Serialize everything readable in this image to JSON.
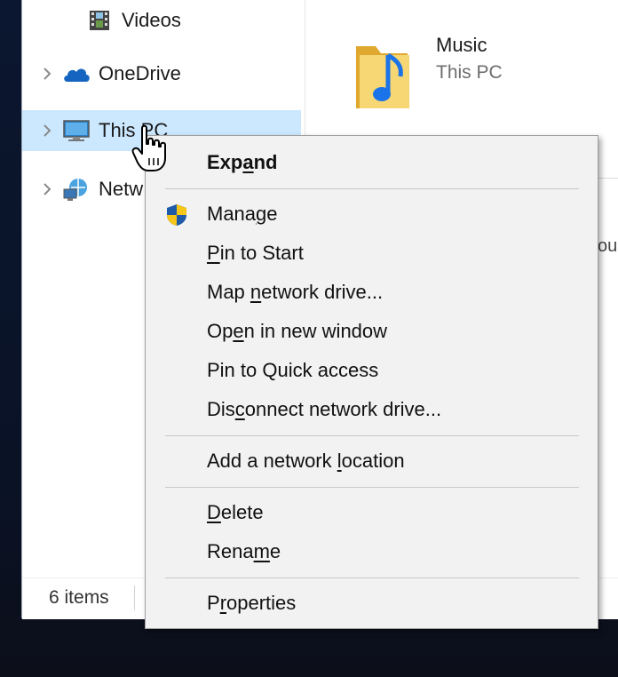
{
  "nav": {
    "items": [
      {
        "label": "Videos",
        "icon": "video-folder-icon",
        "has_chevron": false
      },
      {
        "label": "OneDrive",
        "icon": "onedrive-cloud-icon",
        "has_chevron": true
      },
      {
        "label": "This PC",
        "icon": "monitor-icon",
        "has_chevron": true,
        "selected": true
      },
      {
        "label": "Netw",
        "icon": "network-icon",
        "has_chevron": true
      }
    ]
  },
  "content": {
    "music_tile": {
      "name": "Music",
      "subtitle": "This PC"
    },
    "partial_text": "ou"
  },
  "status": {
    "item_count": "6 items"
  },
  "context_menu": {
    "items": {
      "expand": {
        "pre": "Exp",
        "key": "a",
        "post": "nd"
      },
      "manage": {
        "pre": "Mana",
        "key": "g",
        "post": "e"
      },
      "pin_start": {
        "pre": "",
        "key": "P",
        "post": "in to Start"
      },
      "map_drive": {
        "pre": "Map ",
        "key": "n",
        "post": "etwork drive..."
      },
      "open_window": {
        "pre": "Op",
        "key": "e",
        "post": "n in new window"
      },
      "pin_quick": {
        "pre": "Pin to Quick access",
        "key": "",
        "post": ""
      },
      "disconnect": {
        "pre": "Dis",
        "key": "c",
        "post": "onnect network drive..."
      },
      "add_location": {
        "pre": "Add a network ",
        "key": "l",
        "post": "ocation"
      },
      "delete": {
        "pre": "",
        "key": "D",
        "post": "elete"
      },
      "rename": {
        "pre": "Rena",
        "key": "m",
        "post": "e"
      },
      "properties": {
        "pre": "P",
        "key": "r",
        "post": "operties"
      }
    }
  },
  "colors": {
    "selection_bg": "#cce8ff",
    "menu_bg": "#f2f2f2",
    "desktop_bg": "#0b1730",
    "folder_yellow": "#f2c94c",
    "music_blue": "#1a73e8"
  }
}
